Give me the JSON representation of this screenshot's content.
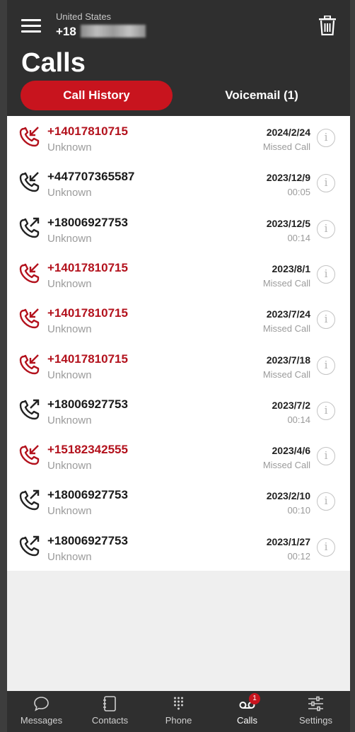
{
  "header": {
    "country": "United States",
    "number_visible": "+18",
    "title": "Calls"
  },
  "tabs": [
    {
      "label": "Call History",
      "active": true
    },
    {
      "label": "Voicemail (1)",
      "active": false
    }
  ],
  "calls": [
    {
      "number": "+14017810715",
      "sub": "Unknown",
      "date": "2024/2/24",
      "detail": "Missed Call",
      "type": "missed"
    },
    {
      "number": "+447707365587",
      "sub": "Unknown",
      "date": "2023/12/9",
      "detail": "00:05",
      "type": "incoming"
    },
    {
      "number": "+18006927753",
      "sub": "Unknown",
      "date": "2023/12/5",
      "detail": "00:14",
      "type": "outgoing"
    },
    {
      "number": "+14017810715",
      "sub": "Unknown",
      "date": "2023/8/1",
      "detail": "Missed Call",
      "type": "missed"
    },
    {
      "number": "+14017810715",
      "sub": "Unknown",
      "date": "2023/7/24",
      "detail": "Missed Call",
      "type": "missed"
    },
    {
      "number": "+14017810715",
      "sub": "Unknown",
      "date": "2023/7/18",
      "detail": "Missed Call",
      "type": "missed"
    },
    {
      "number": "+18006927753",
      "sub": "Unknown",
      "date": "2023/7/2",
      "detail": "00:14",
      "type": "outgoing"
    },
    {
      "number": "+15182342555",
      "sub": "Unknown",
      "date": "2023/4/6",
      "detail": "Missed Call",
      "type": "missed"
    },
    {
      "number": "+18006927753",
      "sub": "Unknown",
      "date": "2023/2/10",
      "detail": "00:10",
      "type": "outgoing"
    },
    {
      "number": "+18006927753",
      "sub": "Unknown",
      "date": "2023/1/27",
      "detail": "00:12",
      "type": "outgoing"
    }
  ],
  "bottom_nav": [
    {
      "label": "Messages",
      "icon": "chat-bubble-icon"
    },
    {
      "label": "Contacts",
      "icon": "contacts-book-icon"
    },
    {
      "label": "Phone",
      "icon": "dialpad-icon"
    },
    {
      "label": "Calls",
      "icon": "voicemail-icon",
      "badge": "1",
      "active": true
    },
    {
      "label": "Settings",
      "icon": "sliders-icon"
    }
  ],
  "colors": {
    "accent": "#c8141e",
    "missed": "#b3121d",
    "background": "#2f2f2f"
  }
}
